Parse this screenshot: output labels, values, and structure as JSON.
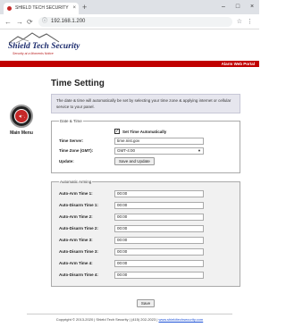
{
  "browser": {
    "tab_title": "SHIELD TECH SECURITY",
    "tab_close": "×",
    "new_tab": "+",
    "url": "192.168.1.200",
    "win_min": "–",
    "win_max": "□",
    "win_close": "×",
    "back": "←",
    "forward": "→",
    "reload": "⟳",
    "star": "☆",
    "menu": "⋮"
  },
  "header": {
    "logo_name": "Shield Tech Security",
    "logo_tagline": "Security at a Moments Notice",
    "portal_label": "Alarm Web Portal"
  },
  "sidebar": {
    "main_menu_label": "Main Menu"
  },
  "main": {
    "title": "Time Setting",
    "notice": "The date & time will automatically be set by selecting your time zone & applying internet or cellular service to your panel."
  },
  "date_time": {
    "legend": "Date & Time",
    "set_auto_label": "Set Time Automatically",
    "set_auto_checked": "✓",
    "time_server_label": "Time Server:",
    "time_server_value": "time.nist.gov",
    "time_zone_label": "Time Zone (GMT):",
    "time_zone_value": "GMT-4:00",
    "update_label": "Update:",
    "save_update_button": "Save and Update"
  },
  "arming": {
    "legend": "Automatic Arming",
    "rows": [
      {
        "label": "Auto-Arm Time 1:",
        "value": "00:00"
      },
      {
        "label": "Auto-Disarm Time 1:",
        "value": "00:00"
      },
      {
        "label": "Auto-Arm Time 2:",
        "value": "00:00"
      },
      {
        "label": "Auto-Disarm Time 2:",
        "value": "00:00"
      },
      {
        "label": "Auto-Arm Time 3:",
        "value": "00:00"
      },
      {
        "label": "Auto-Disarm Time 3:",
        "value": "00:00"
      },
      {
        "label": "Auto-Arm Time 4:",
        "value": "00:00"
      },
      {
        "label": "Auto-Disarm Time 4:",
        "value": "00:00"
      }
    ]
  },
  "save_button": "Save",
  "footer": {
    "text": "Copyright © 2013-2020 | Shield Tech Security | (415) 202-2023 |",
    "link": "www.shieldtechsecurity.com"
  },
  "colors": {
    "accent_red": "#c00000",
    "brand_navy": "#1a2a6c"
  }
}
